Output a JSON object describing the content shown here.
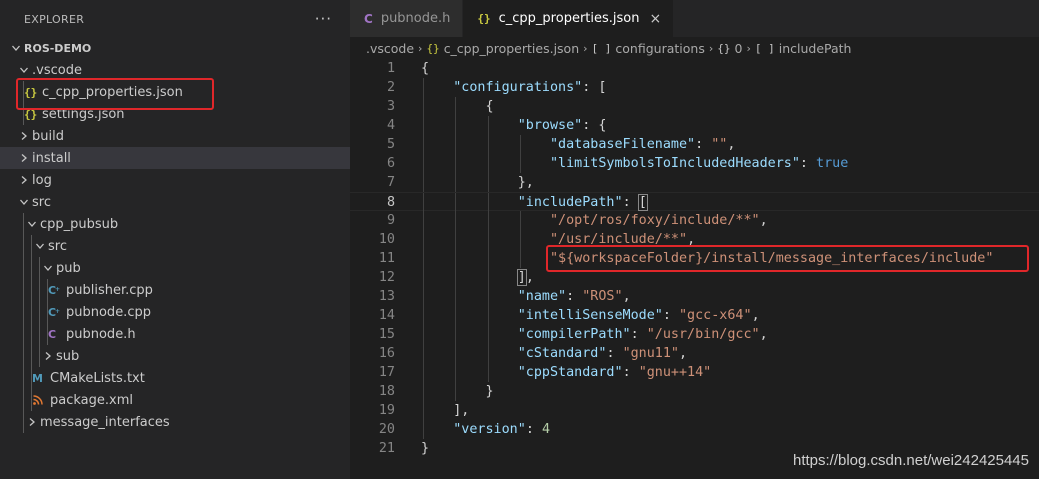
{
  "sidebar": {
    "title": "EXPLORER",
    "more": "···",
    "items": [
      {
        "label": "ROS-DEMO",
        "type": "root"
      },
      {
        "label": ".vscode",
        "type": "folder-open"
      },
      {
        "label": "c_cpp_properties.json",
        "type": "json"
      },
      {
        "label": "settings.json",
        "type": "json"
      },
      {
        "label": "build",
        "type": "folder"
      },
      {
        "label": "install",
        "type": "folder"
      },
      {
        "label": "log",
        "type": "folder"
      },
      {
        "label": "src",
        "type": "folder-open"
      },
      {
        "label": "cpp_pubsub",
        "type": "folder-open"
      },
      {
        "label": "src",
        "type": "folder-open"
      },
      {
        "label": "pub",
        "type": "folder-open"
      },
      {
        "label": "publisher.cpp",
        "type": "cpp"
      },
      {
        "label": "pubnode.cpp",
        "type": "cpp"
      },
      {
        "label": "pubnode.h",
        "type": "h"
      },
      {
        "label": "sub",
        "type": "folder"
      },
      {
        "label": "CMakeLists.txt",
        "type": "cmake"
      },
      {
        "label": "package.xml",
        "type": "xml"
      },
      {
        "label": "message_interfaces",
        "type": "folder"
      }
    ]
  },
  "tabs": [
    {
      "label": "pubnode.h",
      "icon": "C"
    },
    {
      "label": "c_cpp_properties.json",
      "icon": "{}",
      "close": "×"
    }
  ],
  "breadcrumb": [
    ".vscode",
    "c_cpp_properties.json",
    "configurations",
    "0",
    "includePath"
  ],
  "code": [
    "{",
    "    \"configurations\": [",
    "        {",
    "            \"browse\": {",
    "                \"databaseFilename\": \"\",",
    "                \"limitSymbolsToIncludedHeaders\": true",
    "            },",
    "            \"includePath\": [",
    "                \"/opt/ros/foxy/include/**\",",
    "                \"/usr/include/**\",",
    "                \"${workspaceFolder}/install/message_interfaces/include\"",
    "            ],",
    "            \"name\": \"ROS\",",
    "            \"intelliSenseMode\": \"gcc-x64\",",
    "            \"compilerPath\": \"/usr/bin/gcc\",",
    "            \"cStandard\": \"gnu11\",",
    "            \"cppStandard\": \"gnu++14\"",
    "        }",
    "    ],",
    "    \"version\": 4",
    "}"
  ],
  "watermark": "https://blog.csdn.net/wei242425445",
  "colors": {
    "annotation": "#e0272a",
    "sidebar_bg": "#252526",
    "editor_bg": "#1e1e1e"
  }
}
